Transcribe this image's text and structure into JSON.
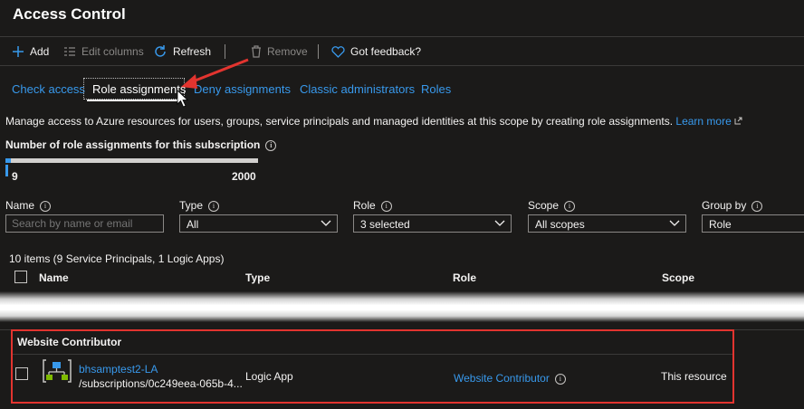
{
  "page": {
    "title": "Access Control"
  },
  "toolbar": {
    "add_label": "Add",
    "edit_columns_label": "Edit columns",
    "refresh_label": "Refresh",
    "remove_label": "Remove",
    "feedback_label": "Got feedback?"
  },
  "tabs": [
    {
      "label": "Check access"
    },
    {
      "label": "Role assignments"
    },
    {
      "label": "Deny assignments"
    },
    {
      "label": "Classic administrators"
    },
    {
      "label": "Roles"
    }
  ],
  "description": {
    "text": "Manage access to Azure resources for users, groups, service principals and managed identities at this scope by creating role assignments.",
    "link": "Learn more"
  },
  "quota": {
    "heading": "Number of role assignments for this subscription",
    "current": "9",
    "max": "2000",
    "fraction": 0.0045
  },
  "filters": {
    "name": {
      "label": "Name",
      "placeholder": "Search by name or email"
    },
    "type": {
      "label": "Type",
      "value": "All"
    },
    "role": {
      "label": "Role",
      "value": "3 selected"
    },
    "scope": {
      "label": "Scope",
      "value": "All scopes"
    },
    "group_by": {
      "label": "Group by",
      "value": "Role"
    }
  },
  "items_summary": "10 items (9 Service Principals, 1 Logic Apps)",
  "table": {
    "columns": [
      "Name",
      "Type",
      "Role",
      "Scope"
    ],
    "group": {
      "label": "Website Contributor",
      "rows": [
        {
          "name": "bhsamptest2-LA",
          "sub": "/subscriptions/0c249eea-065b-4...",
          "type": "Logic App",
          "role": "Website Contributor",
          "scope": "This resource"
        }
      ]
    }
  },
  "colors": {
    "accent": "#3899ec",
    "background": "#1b1a19",
    "highlight": "#e2342f"
  }
}
